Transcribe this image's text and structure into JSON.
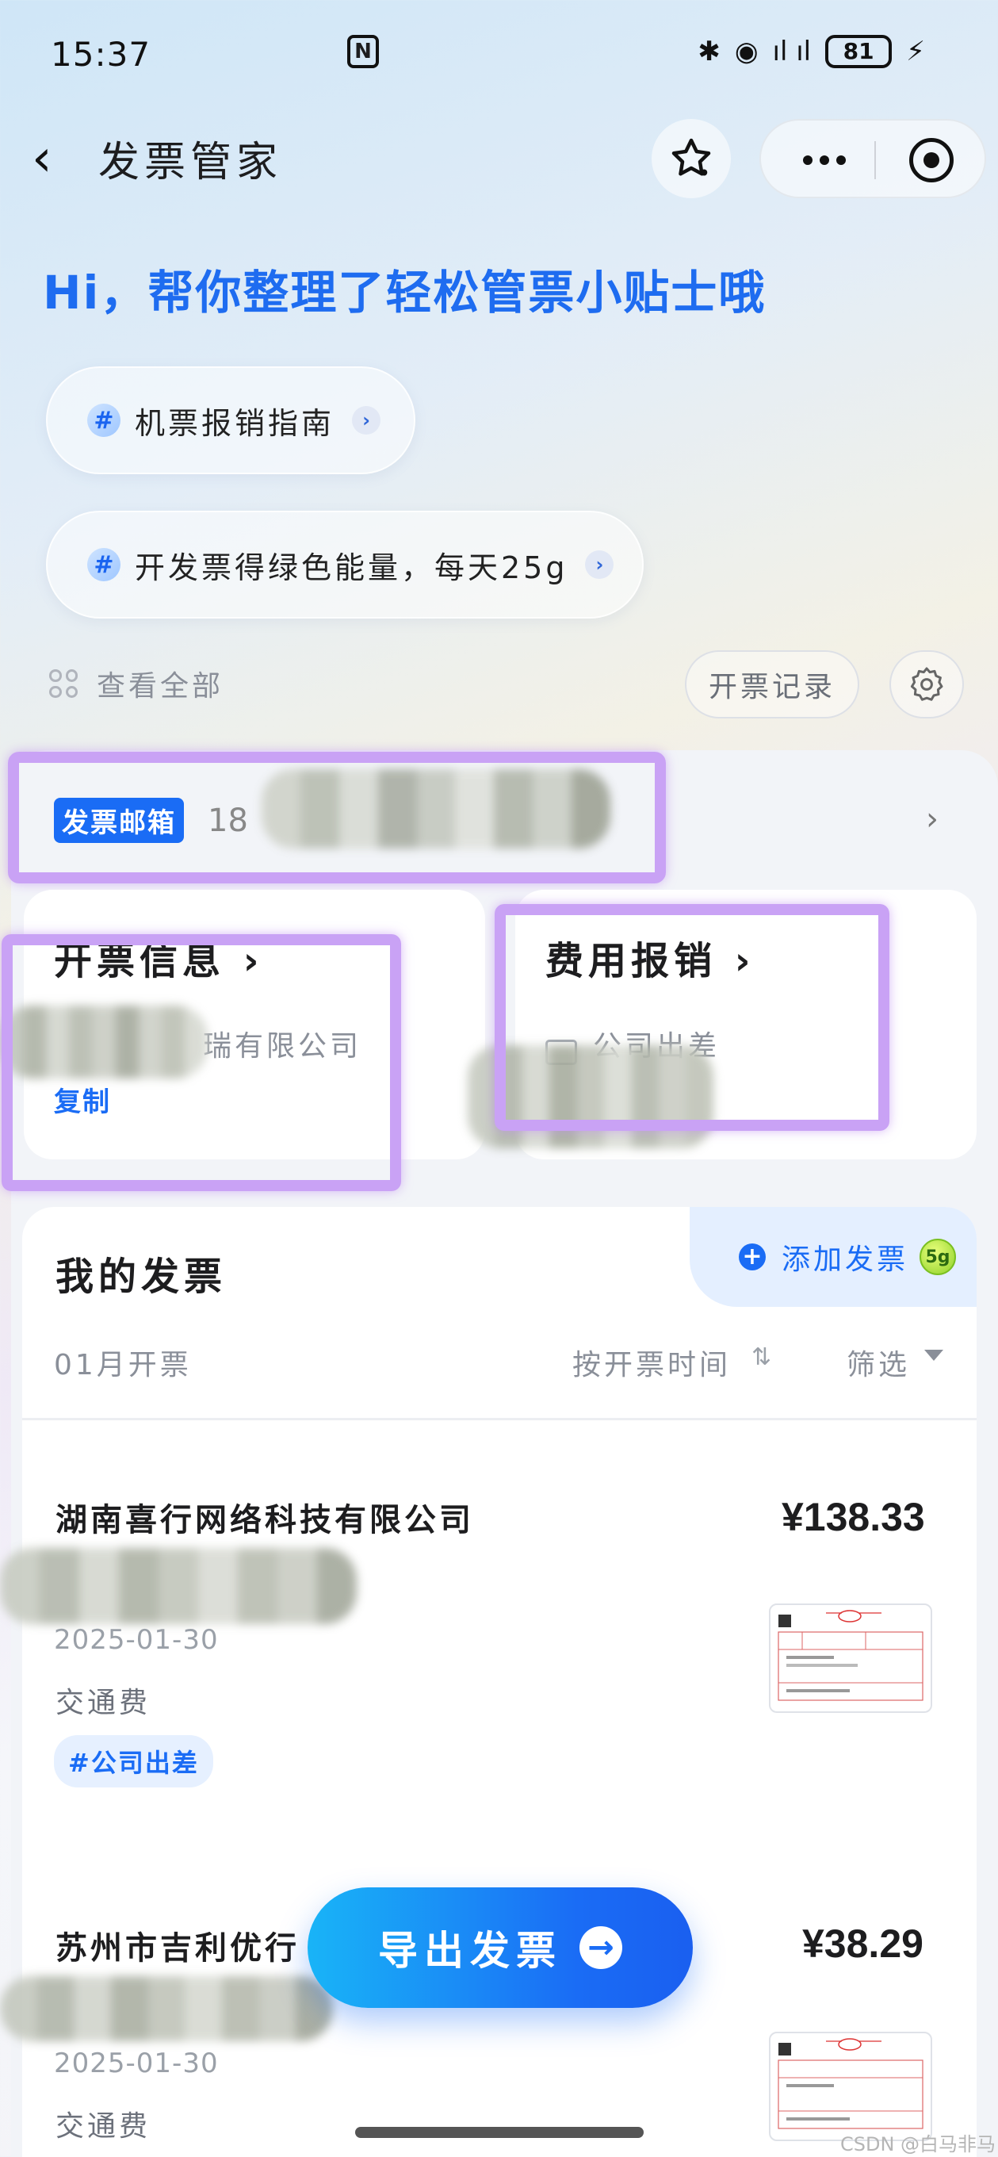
{
  "status_bar": {
    "time": "15:37",
    "signal_text": "ıl ıl",
    "battery": "81"
  },
  "header": {
    "back_glyph": "‹",
    "title": "发票管家"
  },
  "greeting": "Hi，帮你整理了轻松管票小贴士哦",
  "tips": [
    {
      "hash": "#",
      "label": "机票报销指南"
    },
    {
      "hash": "#",
      "label": "开发票得绿色能量，每天25g"
    }
  ],
  "view_all": "查看全部",
  "record_button": "开票记录",
  "mailbox": {
    "badge": "发票邮箱",
    "number_prefix": "18",
    "arrow": "›"
  },
  "billing_info": {
    "title": "开票信息",
    "company_suffix": "瑞有限公司",
    "copy": "复制"
  },
  "expense": {
    "title": "费用报销",
    "category": "公司出差"
  },
  "invoices_section": {
    "title": "我的发票",
    "add_label": "添加发票",
    "add_badge": "5g",
    "month": "01月开票",
    "sort": "按开票时间",
    "filter": "筛选"
  },
  "invoices": [
    {
      "company": "湖南喜行网络科技有限公司",
      "amount": "¥138.33",
      "date": "2025-01-30",
      "type": "交通费",
      "tag": "#公司出差"
    },
    {
      "company": "苏州市吉利优行",
      "amount": "¥38.29",
      "date": "2025-01-30",
      "type": "交通费",
      "tag": ""
    }
  ],
  "export_button": "导出发票",
  "watermark": "CSDN @白马非马",
  "colors": {
    "accent": "#1a6cf5",
    "highlight": "#c9a2f5"
  }
}
